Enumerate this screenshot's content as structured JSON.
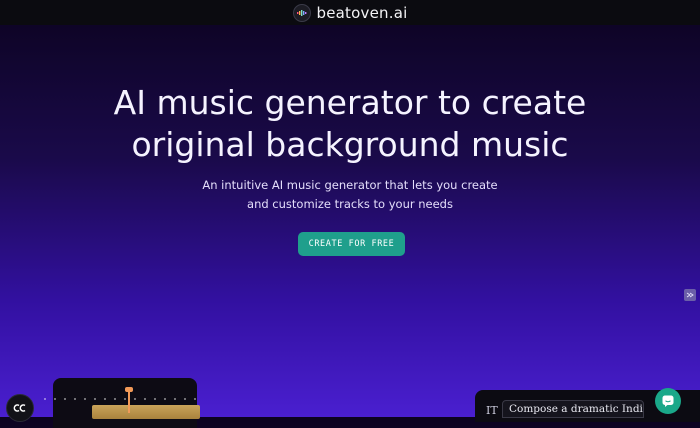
{
  "brand": {
    "name": "beatoven.ai",
    "logo_icon": "beatoven-logo-icon"
  },
  "hero": {
    "title_line1": "AI music generator to create",
    "title_line2": "original background music",
    "subtitle_line1": "An intuitive AI music generator that lets you create",
    "subtitle_line2": "and customize tracks to your needs",
    "cta_label": "CREATE FOR FREE"
  },
  "prompt": {
    "icon_text": "IT",
    "text": "Compose a dramatic Indian"
  },
  "colors": {
    "accent": "#1f9f8c",
    "chat": "#1aa889",
    "playhead": "#f29a58",
    "top_bar": "#0b0b10"
  }
}
